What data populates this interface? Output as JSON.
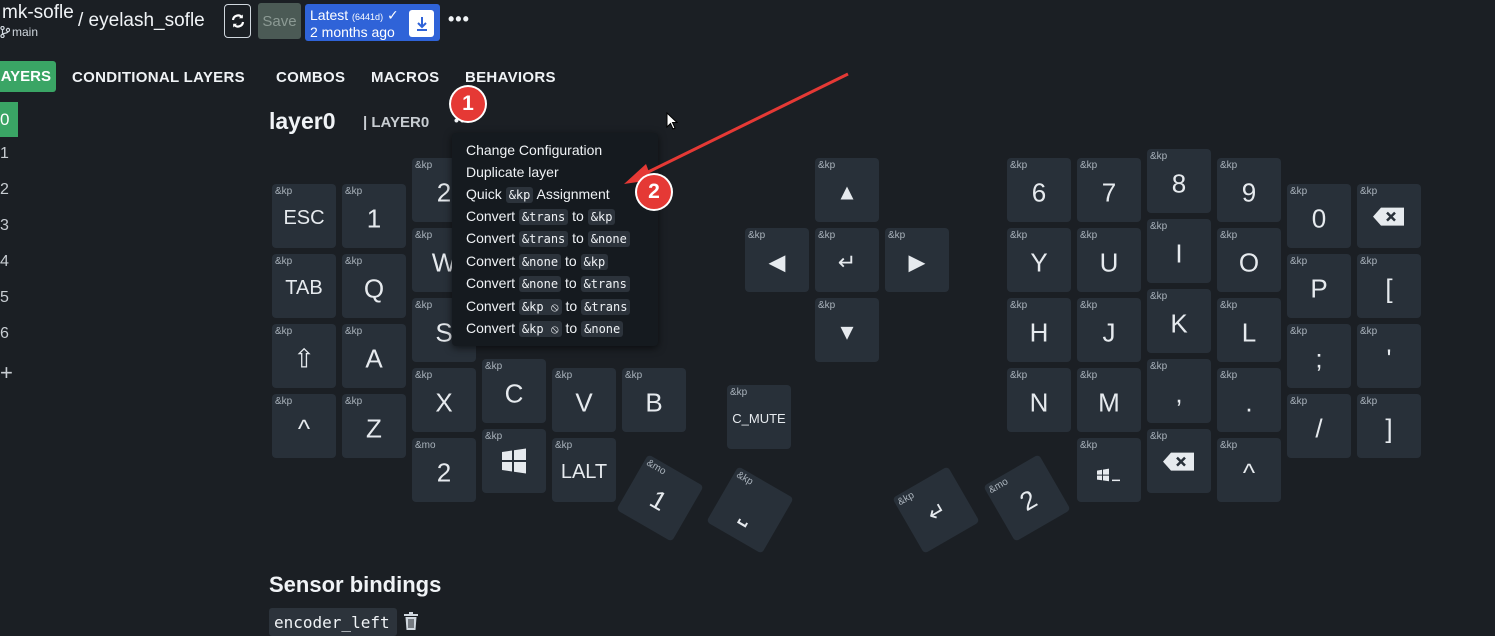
{
  "header": {
    "repo": "mk-sofle",
    "branch": "main",
    "keyboard": "/ eyelash_sofle",
    "save": "Save",
    "latest": "Latest",
    "hash": "6441d",
    "ago": "2 months ago",
    "more": "•••"
  },
  "tabs": [
    "AYERS",
    "CONDITIONAL LAYERS",
    "COMBOS",
    "MACROS",
    "BEHAVIORS"
  ],
  "sidebar": {
    "selected": "0",
    "layers": [
      "1",
      "2",
      "3",
      "4",
      "5",
      "6"
    ],
    "add": "+"
  },
  "layer": {
    "title": "layer0",
    "subtitle": "| LAYER0",
    "more": "•••"
  },
  "menu": {
    "items": [
      {
        "pre": "Change Configuration"
      },
      {
        "pre": "Duplicate layer"
      },
      {
        "pre": "Quick",
        "c1": "&kp",
        "mid": "Assignment"
      },
      {
        "pre": "Convert",
        "c1": "&trans",
        "mid": "to",
        "c2": "&kp"
      },
      {
        "pre": "Convert",
        "c1": "&trans",
        "mid": "to",
        "c2": "&none"
      },
      {
        "pre": "Convert",
        "c1": "&none",
        "mid": "to",
        "c2": "&kp"
      },
      {
        "pre": "Convert",
        "c1": "&none",
        "mid": "to",
        "c2": "&trans"
      },
      {
        "pre": "Convert",
        "c1": "&kp ⦸",
        "mid": "to",
        "c2": "&trans"
      },
      {
        "pre": "Convert",
        "c1": "&kp ⦸",
        "mid": "to",
        "c2": "&none"
      }
    ]
  },
  "keys": [
    {
      "tag": "&kp",
      "label": "ESC"
    },
    {
      "tag": "&kp",
      "label": "1"
    },
    {
      "tag": "&kp",
      "label": "2"
    },
    {
      "tag": "&kp",
      "label": "TAB"
    },
    {
      "tag": "&kp",
      "label": "Q"
    },
    {
      "tag": "&kp",
      "label": "W"
    },
    {
      "tag": "&kp",
      "label": "⇧"
    },
    {
      "tag": "&kp",
      "label": "A"
    },
    {
      "tag": "&kp",
      "label": "S"
    },
    {
      "tag": "&kp",
      "label": "^"
    },
    {
      "tag": "&kp",
      "label": "Z"
    },
    {
      "tag": "&kp",
      "label": "X"
    },
    {
      "tag": "&kp",
      "label": "C"
    },
    {
      "tag": "&kp",
      "label": "V"
    },
    {
      "tag": "&kp",
      "label": "B"
    },
    {
      "tag": "&mo",
      "label": "2"
    },
    {
      "tag": "&kp",
      "label": "win-icon"
    },
    {
      "tag": "&kp",
      "label": "LALT"
    },
    {
      "tag": "&mo",
      "label": "1"
    },
    {
      "tag": "&kp",
      "label": "⎵"
    },
    {
      "tag": "&kp",
      "label": "▲"
    },
    {
      "tag": "&kp",
      "label": "◀"
    },
    {
      "tag": "&kp",
      "label": "↵"
    },
    {
      "tag": "&kp",
      "label": "▶"
    },
    {
      "tag": "&kp",
      "label": "▼"
    },
    {
      "tag": "&kp",
      "label": "C_MUTE"
    },
    {
      "tag": "&kp",
      "label": "6"
    },
    {
      "tag": "&kp",
      "label": "7"
    },
    {
      "tag": "&kp",
      "label": "8"
    },
    {
      "tag": "&kp",
      "label": "9"
    },
    {
      "tag": "&kp",
      "label": "0"
    },
    {
      "tag": "&kp",
      "label": "⌫"
    },
    {
      "tag": "&kp",
      "label": "Y"
    },
    {
      "tag": "&kp",
      "label": "U"
    },
    {
      "tag": "&kp",
      "label": "I"
    },
    {
      "tag": "&kp",
      "label": "O"
    },
    {
      "tag": "&kp",
      "label": "P"
    },
    {
      "tag": "&kp",
      "label": "["
    },
    {
      "tag": "&kp",
      "label": "H"
    },
    {
      "tag": "&kp",
      "label": "J"
    },
    {
      "tag": "&kp",
      "label": "K"
    },
    {
      "tag": "&kp",
      "label": "L"
    },
    {
      "tag": "&kp",
      "label": ";"
    },
    {
      "tag": "&kp",
      "label": "'"
    },
    {
      "tag": "&kp",
      "label": "N"
    },
    {
      "tag": "&kp",
      "label": "M"
    },
    {
      "tag": "&kp",
      "label": ","
    },
    {
      "tag": "&kp",
      "label": "."
    },
    {
      "tag": "&kp",
      "label": "/"
    },
    {
      "tag": "&kp",
      "label": "]"
    },
    {
      "tag": "&kp",
      "label": "win-icon-small"
    },
    {
      "tag": "&kp",
      "label": "del-icon"
    },
    {
      "tag": "&kp",
      "label": "^"
    },
    {
      "tag": "&kp",
      "label": "↵"
    },
    {
      "tag": "&mo",
      "label": "2"
    }
  ],
  "annotations": {
    "one": "1",
    "two": "2"
  },
  "sensor": {
    "title": "Sensor bindings",
    "encoder": "encoder_left"
  }
}
